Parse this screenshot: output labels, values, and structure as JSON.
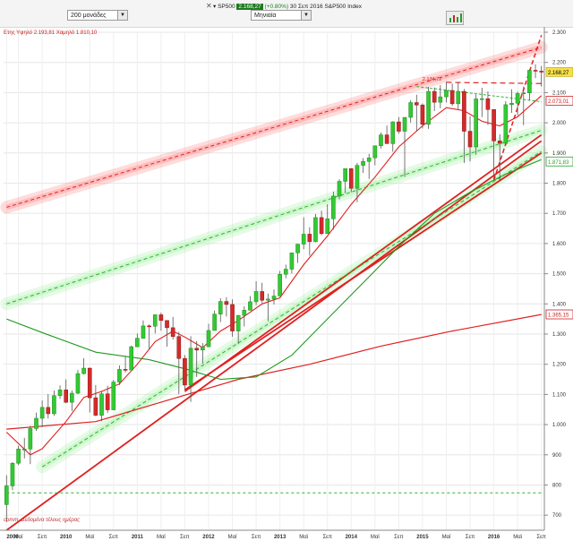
{
  "toolbar": {
    "bars_select": "200 μονάδες",
    "period_select": "Μηνιαία",
    "title_symbol": "SP500",
    "title_price": "2.168,27",
    "title_change": "(+0.80%)",
    "title_date": "30 Σεπ 2016",
    "title_name": "S&P500 Index"
  },
  "chart_data": {
    "type": "candlestick",
    "subtitle": "Ετης Υψηλό 2.193,81 Χαμηλό 1.810,10",
    "watermark": "comm. Δεδομένα τέλους ημέρας",
    "peak_label": "2.134,72",
    "ylim": [
      650,
      2300
    ],
    "y_ticks": [
      700,
      800,
      900,
      1000,
      1100,
      1200,
      1300,
      1400,
      1500,
      1600,
      1700,
      1800,
      1900,
      2000,
      2100,
      2200,
      2300
    ],
    "y_tick_labels": [
      "700",
      "800",
      "900",
      "1.000",
      "1.100",
      "1.200",
      "1.300",
      "1.400",
      "1.500",
      "1.600",
      "1.700",
      "1.800",
      "1.900",
      "2.000",
      "2.100",
      "2.200",
      "2.300"
    ],
    "x_start": "2009-03",
    "x_end": "2016-09",
    "x_labels": [
      {
        "date": "2009-03",
        "text": "2009"
      },
      {
        "date": "2009-05",
        "text": "Μαϊ"
      },
      {
        "date": "2009-09",
        "text": "Σεπ"
      },
      {
        "date": "2010-01",
        "text": "2010"
      },
      {
        "date": "2010-05",
        "text": "Μαϊ"
      },
      {
        "date": "2010-09",
        "text": "Σεπ"
      },
      {
        "date": "2011-01",
        "text": "2011"
      },
      {
        "date": "2011-05",
        "text": "Μαϊ"
      },
      {
        "date": "2011-09",
        "text": "Σεπ"
      },
      {
        "date": "2012-01",
        "text": "2012"
      },
      {
        "date": "2012-05",
        "text": "Μαϊ"
      },
      {
        "date": "2012-09",
        "text": "Σεπ"
      },
      {
        "date": "2013-01",
        "text": "2013"
      },
      {
        "date": "2013-05",
        "text": "Μαϊ"
      },
      {
        "date": "2013-09",
        "text": "Σεπ"
      },
      {
        "date": "2014-01",
        "text": "2014"
      },
      {
        "date": "2014-05",
        "text": "Μαϊ"
      },
      {
        "date": "2014-09",
        "text": "Σεπ"
      },
      {
        "date": "2015-01",
        "text": "2015"
      },
      {
        "date": "2015-05",
        "text": "Μαϊ"
      },
      {
        "date": "2015-09",
        "text": "Σεπ"
      },
      {
        "date": "2016-01",
        "text": "2016"
      },
      {
        "date": "2016-05",
        "text": "Μαϊ"
      },
      {
        "date": "2016-09",
        "text": "Σεπ"
      }
    ],
    "candles": [
      {
        "d": "2009-03",
        "o": 735,
        "h": 832,
        "l": 677,
        "c": 797
      },
      {
        "d": "2009-04",
        "o": 797,
        "h": 876,
        "l": 783,
        "c": 872
      },
      {
        "d": "2009-05",
        "o": 872,
        "h": 930,
        "l": 866,
        "c": 919
      },
      {
        "d": "2009-06",
        "o": 919,
        "h": 956,
        "l": 888,
        "c": 919
      },
      {
        "d": "2009-07",
        "o": 919,
        "h": 996,
        "l": 869,
        "c": 987
      },
      {
        "d": "2009-08",
        "o": 987,
        "h": 1040,
        "l": 979,
        "c": 1021
      },
      {
        "d": "2009-09",
        "o": 1021,
        "h": 1080,
        "l": 992,
        "c": 1057
      },
      {
        "d": "2009-10",
        "o": 1057,
        "h": 1101,
        "l": 1020,
        "c": 1036
      },
      {
        "d": "2009-11",
        "o": 1036,
        "h": 1113,
        "l": 1029,
        "c": 1096
      },
      {
        "d": "2009-12",
        "o": 1096,
        "h": 1130,
        "l": 1085,
        "c": 1115
      },
      {
        "d": "2010-01",
        "o": 1115,
        "h": 1150,
        "l": 1071,
        "c": 1074
      },
      {
        "d": "2010-02",
        "o": 1074,
        "h": 1113,
        "l": 1045,
        "c": 1104
      },
      {
        "d": "2010-03",
        "o": 1104,
        "h": 1181,
        "l": 1101,
        "c": 1169
      },
      {
        "d": "2010-04",
        "o": 1169,
        "h": 1220,
        "l": 1166,
        "c": 1187
      },
      {
        "d": "2010-05",
        "o": 1187,
        "h": 1189,
        "l": 1040,
        "c": 1089
      },
      {
        "d": "2010-06",
        "o": 1089,
        "h": 1131,
        "l": 1028,
        "c": 1031
      },
      {
        "d": "2010-07",
        "o": 1031,
        "h": 1112,
        "l": 1011,
        "c": 1102
      },
      {
        "d": "2010-08",
        "o": 1102,
        "h": 1129,
        "l": 1039,
        "c": 1049
      },
      {
        "d": "2010-09",
        "o": 1049,
        "h": 1148,
        "l": 1048,
        "c": 1141
      },
      {
        "d": "2010-10",
        "o": 1141,
        "h": 1196,
        "l": 1131,
        "c": 1183
      },
      {
        "d": "2010-11",
        "o": 1183,
        "h": 1227,
        "l": 1173,
        "c": 1181
      },
      {
        "d": "2010-12",
        "o": 1181,
        "h": 1262,
        "l": 1181,
        "c": 1258
      },
      {
        "d": "2011-01",
        "o": 1258,
        "h": 1302,
        "l": 1257,
        "c": 1286
      },
      {
        "d": "2011-02",
        "o": 1286,
        "h": 1345,
        "l": 1289,
        "c": 1327
      },
      {
        "d": "2011-03",
        "o": 1327,
        "h": 1332,
        "l": 1249,
        "c": 1326
      },
      {
        "d": "2011-04",
        "o": 1326,
        "h": 1364,
        "l": 1302,
        "c": 1364
      },
      {
        "d": "2011-05",
        "o": 1364,
        "h": 1371,
        "l": 1311,
        "c": 1345
      },
      {
        "d": "2011-06",
        "o": 1345,
        "h": 1346,
        "l": 1258,
        "c": 1321
      },
      {
        "d": "2011-07",
        "o": 1321,
        "h": 1357,
        "l": 1282,
        "c": 1292
      },
      {
        "d": "2011-08",
        "o": 1292,
        "h": 1307,
        "l": 1101,
        "c": 1219
      },
      {
        "d": "2011-09",
        "o": 1219,
        "h": 1230,
        "l": 1114,
        "c": 1131
      },
      {
        "d": "2011-10",
        "o": 1131,
        "h": 1293,
        "l": 1075,
        "c": 1253
      },
      {
        "d": "2011-11",
        "o": 1253,
        "h": 1277,
        "l": 1158,
        "c": 1247
      },
      {
        "d": "2011-12",
        "o": 1247,
        "h": 1270,
        "l": 1202,
        "c": 1258
      },
      {
        "d": "2012-01",
        "o": 1258,
        "h": 1334,
        "l": 1258,
        "c": 1312
      },
      {
        "d": "2012-02",
        "o": 1312,
        "h": 1378,
        "l": 1312,
        "c": 1366
      },
      {
        "d": "2012-03",
        "o": 1366,
        "h": 1419,
        "l": 1340,
        "c": 1408
      },
      {
        "d": "2012-04",
        "o": 1408,
        "h": 1422,
        "l": 1358,
        "c": 1398
      },
      {
        "d": "2012-05",
        "o": 1398,
        "h": 1415,
        "l": 1291,
        "c": 1310
      },
      {
        "d": "2012-06",
        "o": 1310,
        "h": 1363,
        "l": 1267,
        "c": 1362
      },
      {
        "d": "2012-07",
        "o": 1362,
        "h": 1392,
        "l": 1325,
        "c": 1379
      },
      {
        "d": "2012-08",
        "o": 1379,
        "h": 1426,
        "l": 1378,
        "c": 1407
      },
      {
        "d": "2012-09",
        "o": 1407,
        "h": 1475,
        "l": 1396,
        "c": 1441
      },
      {
        "d": "2012-10",
        "o": 1441,
        "h": 1470,
        "l": 1403,
        "c": 1412
      },
      {
        "d": "2012-11",
        "o": 1412,
        "h": 1434,
        "l": 1343,
        "c": 1416
      },
      {
        "d": "2012-12",
        "o": 1416,
        "h": 1448,
        "l": 1398,
        "c": 1426
      },
      {
        "d": "2013-01",
        "o": 1426,
        "h": 1509,
        "l": 1426,
        "c": 1498
      },
      {
        "d": "2013-02",
        "o": 1498,
        "h": 1530,
        "l": 1485,
        "c": 1515
      },
      {
        "d": "2013-03",
        "o": 1515,
        "h": 1570,
        "l": 1501,
        "c": 1569
      },
      {
        "d": "2013-04",
        "o": 1569,
        "h": 1598,
        "l": 1536,
        "c": 1598
      },
      {
        "d": "2013-05",
        "o": 1598,
        "h": 1687,
        "l": 1581,
        "c": 1631
      },
      {
        "d": "2013-06",
        "o": 1631,
        "h": 1654,
        "l": 1560,
        "c": 1606
      },
      {
        "d": "2013-07",
        "o": 1606,
        "h": 1698,
        "l": 1604,
        "c": 1686
      },
      {
        "d": "2013-08",
        "o": 1686,
        "h": 1709,
        "l": 1627,
        "c": 1633
      },
      {
        "d": "2013-09",
        "o": 1633,
        "h": 1730,
        "l": 1633,
        "c": 1682
      },
      {
        "d": "2013-10",
        "o": 1682,
        "h": 1772,
        "l": 1646,
        "c": 1757
      },
      {
        "d": "2013-11",
        "o": 1757,
        "h": 1813,
        "l": 1746,
        "c": 1806
      },
      {
        "d": "2013-12",
        "o": 1806,
        "h": 1849,
        "l": 1767,
        "c": 1848
      },
      {
        "d": "2014-01",
        "o": 1848,
        "h": 1850,
        "l": 1770,
        "c": 1783
      },
      {
        "d": "2014-02",
        "o": 1783,
        "h": 1867,
        "l": 1737,
        "c": 1859
      },
      {
        "d": "2014-03",
        "o": 1859,
        "h": 1883,
        "l": 1834,
        "c": 1872
      },
      {
        "d": "2014-04",
        "o": 1872,
        "h": 1897,
        "l": 1814,
        "c": 1884
      },
      {
        "d": "2014-05",
        "o": 1884,
        "h": 1924,
        "l": 1859,
        "c": 1924
      },
      {
        "d": "2014-06",
        "o": 1924,
        "h": 1968,
        "l": 1915,
        "c": 1960
      },
      {
        "d": "2014-07",
        "o": 1960,
        "h": 1991,
        "l": 1930,
        "c": 1931
      },
      {
        "d": "2014-08",
        "o": 1931,
        "h": 2005,
        "l": 1904,
        "c": 2003
      },
      {
        "d": "2014-09",
        "o": 2003,
        "h": 2019,
        "l": 1964,
        "c": 1972
      },
      {
        "d": "2014-10",
        "o": 1972,
        "h": 2018,
        "l": 1821,
        "c": 2018
      },
      {
        "d": "2014-11",
        "o": 2018,
        "h": 2075,
        "l": 2001,
        "c": 2067
      },
      {
        "d": "2014-12",
        "o": 2067,
        "h": 2093,
        "l": 1972,
        "c": 2059
      },
      {
        "d": "2015-01",
        "o": 2059,
        "h": 2064,
        "l": 1981,
        "c": 1995
      },
      {
        "d": "2015-02",
        "o": 1995,
        "h": 2119,
        "l": 1980,
        "c": 2104
      },
      {
        "d": "2015-03",
        "o": 2104,
        "h": 2117,
        "l": 2039,
        "c": 2068
      },
      {
        "d": "2015-04",
        "o": 2068,
        "h": 2125,
        "l": 2048,
        "c": 2086
      },
      {
        "d": "2015-05",
        "o": 2086,
        "h": 2135,
        "l": 2067,
        "c": 2107
      },
      {
        "d": "2015-06",
        "o": 2107,
        "h": 2130,
        "l": 2056,
        "c": 2063
      },
      {
        "d": "2015-07",
        "o": 2063,
        "h": 2133,
        "l": 2044,
        "c": 2104
      },
      {
        "d": "2015-08",
        "o": 2104,
        "h": 2112,
        "l": 1867,
        "c": 1972
      },
      {
        "d": "2015-09",
        "o": 1972,
        "h": 2021,
        "l": 1872,
        "c": 1920
      },
      {
        "d": "2015-10",
        "o": 1920,
        "h": 2094,
        "l": 1894,
        "c": 2079
      },
      {
        "d": "2015-11",
        "o": 2079,
        "h": 2116,
        "l": 2019,
        "c": 2080
      },
      {
        "d": "2015-12",
        "o": 2080,
        "h": 2104,
        "l": 1993,
        "c": 2044
      },
      {
        "d": "2016-01",
        "o": 2044,
        "h": 2038,
        "l": 1812,
        "c": 1940
      },
      {
        "d": "2016-02",
        "o": 1940,
        "h": 1962,
        "l": 1810,
        "c": 1932
      },
      {
        "d": "2016-03",
        "o": 1932,
        "h": 2072,
        "l": 1937,
        "c": 2060
      },
      {
        "d": "2016-04",
        "o": 2060,
        "h": 2111,
        "l": 2033,
        "c": 2065
      },
      {
        "d": "2016-05",
        "o": 2065,
        "h": 2103,
        "l": 2025,
        "c": 2097
      },
      {
        "d": "2016-06",
        "o": 2097,
        "h": 2120,
        "l": 1992,
        "c": 2099
      },
      {
        "d": "2016-07",
        "o": 2099,
        "h": 2177,
        "l": 2074,
        "c": 2174
      },
      {
        "d": "2016-08",
        "o": 2174,
        "h": 2194,
        "l": 2148,
        "c": 2171
      },
      {
        "d": "2016-09",
        "o": 2171,
        "h": 2188,
        "l": 2120,
        "c": 2168
      }
    ],
    "price_flags": [
      {
        "value": 2168.27,
        "text": "2.168,27",
        "style": "current"
      },
      {
        "value": 2073.01,
        "text": "2.073,01",
        "color": "#d02020"
      },
      {
        "value": 1871.83,
        "text": "1.871,83",
        "color": "#2aa12a"
      },
      {
        "value": 1365.15,
        "text": "1.365,15",
        "color": "#d02020"
      }
    ],
    "ma_fast": [
      [
        "2009-03",
        975
      ],
      [
        "2009-07",
        900
      ],
      [
        "2009-09",
        920
      ],
      [
        "2010-01",
        1010
      ],
      [
        "2010-04",
        1090
      ],
      [
        "2010-07",
        1110
      ],
      [
        "2010-10",
        1135
      ],
      [
        "2011-01",
        1200
      ],
      [
        "2011-04",
        1275
      ],
      [
        "2011-07",
        1310
      ],
      [
        "2011-09",
        1290
      ],
      [
        "2011-12",
        1255
      ],
      [
        "2012-03",
        1310
      ],
      [
        "2012-06",
        1345
      ],
      [
        "2012-10",
        1400
      ],
      [
        "2013-01",
        1420
      ],
      [
        "2013-05",
        1530
      ],
      [
        "2013-09",
        1625
      ],
      [
        "2014-01",
        1730
      ],
      [
        "2014-05",
        1820
      ],
      [
        "2014-09",
        1920
      ],
      [
        "2015-01",
        1990
      ],
      [
        "2015-05",
        2050
      ],
      [
        "2015-08",
        2040
      ],
      [
        "2015-11",
        2005
      ],
      [
        "2016-02",
        1990
      ],
      [
        "2016-05",
        2020
      ],
      [
        "2016-09",
        2090
      ]
    ],
    "ma_mid": [
      [
        "2009-03",
        1350
      ],
      [
        "2009-09",
        1305
      ],
      [
        "2010-06",
        1240
      ],
      [
        "2011-03",
        1215
      ],
      [
        "2011-09",
        1185
      ],
      [
        "2012-03",
        1150
      ],
      [
        "2012-09",
        1158
      ],
      [
        "2013-03",
        1230
      ],
      [
        "2013-09",
        1350
      ],
      [
        "2014-03",
        1470
      ],
      [
        "2014-09",
        1590
      ],
      [
        "2015-03",
        1700
      ],
      [
        "2015-09",
        1770
      ],
      [
        "2016-03",
        1830
      ],
      [
        "2016-09",
        1878
      ]
    ],
    "ma_slow": [
      [
        "2009-03",
        985
      ],
      [
        "2010-06",
        1010
      ],
      [
        "2011-06",
        1080
      ],
      [
        "2012-06",
        1150
      ],
      [
        "2013-06",
        1200
      ],
      [
        "2014-06",
        1260
      ],
      [
        "2015-06",
        1310
      ],
      [
        "2016-09",
        1365
      ]
    ],
    "trend_lines": [
      {
        "color": "#e02020",
        "width": 1.8,
        "dash": "",
        "pts": [
          [
            "2009-03",
            650
          ],
          [
            "2016-09",
            1940
          ]
        ]
      },
      {
        "color": "#e02020",
        "width": 1.8,
        "dash": "",
        "pts": [
          [
            "2011-09",
            1110
          ],
          [
            "2016-09",
            1960
          ]
        ]
      },
      {
        "color": "#e02020",
        "width": 1.8,
        "dash": "",
        "pts": [
          [
            "2011-09",
            1115
          ],
          [
            "2016-09",
            1900
          ]
        ]
      },
      {
        "color": "#e02020",
        "width": 1.5,
        "dash": "5,3",
        "pts": [
          [
            "2016-01",
            1810
          ],
          [
            "2016-09",
            2290
          ]
        ]
      },
      {
        "color": "#e02020",
        "width": 1.2,
        "dash": "6,4",
        "pts": [
          [
            "2015-05",
            2134
          ],
          [
            "2016-09",
            2130
          ]
        ]
      },
      {
        "color": "#e02020",
        "width": 1,
        "dash": "4,3",
        "glow": "#ff8080",
        "pts": [
          [
            "2009-03",
            1720
          ],
          [
            "2016-09",
            2250
          ]
        ]
      },
      {
        "color": "#30b030",
        "width": 1,
        "dash": "4,3",
        "glow": "#a0f0a0",
        "pts": [
          [
            "2009-03",
            1400
          ],
          [
            "2016-09",
            1975
          ]
        ]
      },
      {
        "color": "#30b030",
        "width": 1,
        "dash": "4,3",
        "glow": "#a0f0a0",
        "pts": [
          [
            "2009-09",
            860
          ],
          [
            "2016-09",
            1905
          ]
        ]
      },
      {
        "color": "#30b030",
        "width": 1,
        "dash": "3,2",
        "pts": [
          [
            "2014-12",
            2120
          ],
          [
            "2016-09",
            2070
          ]
        ]
      },
      {
        "color": "#30b030",
        "width": 1,
        "dash": "3,3",
        "pts": [
          [
            "2009-03",
            774
          ],
          [
            "2016-09",
            774
          ]
        ]
      }
    ]
  }
}
